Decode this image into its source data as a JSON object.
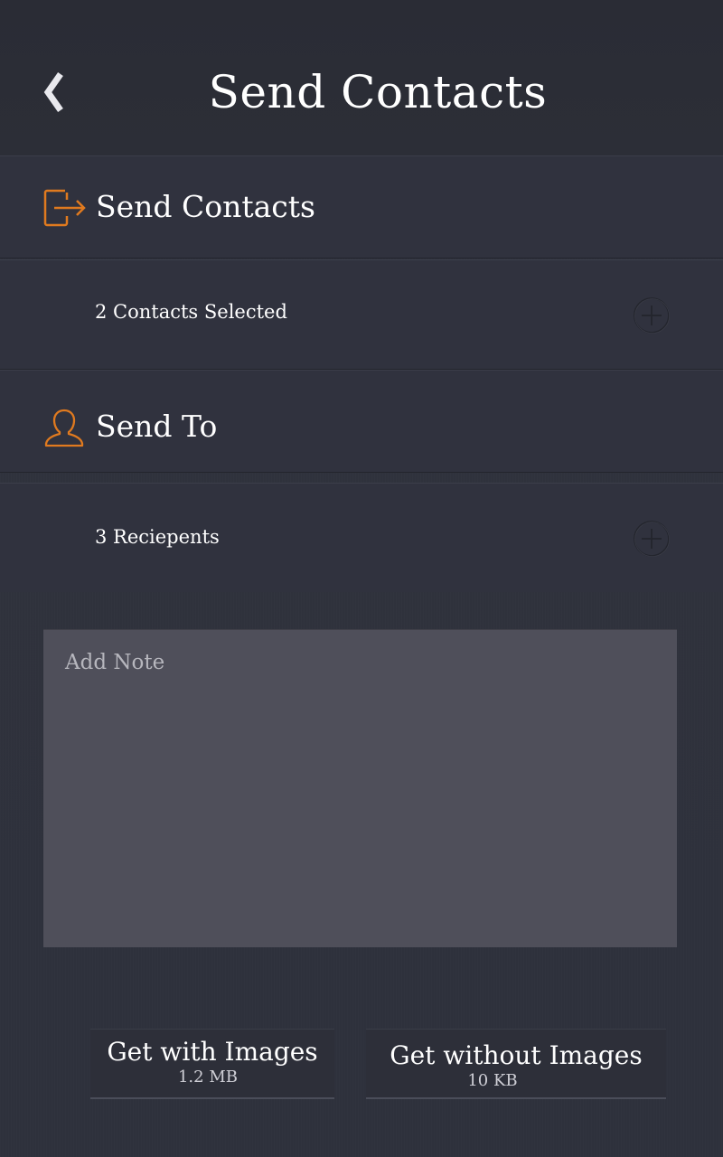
{
  "header": {
    "title": "Send Contacts",
    "back_icon": "chevron-left-icon"
  },
  "send_contacts_section": {
    "label": "Send Contacts",
    "icon": "sign-out-icon",
    "icon_color": "#e07a1f",
    "row_label": "2 Contacts Selected",
    "row_action_icon": "plus-circle-icon"
  },
  "send_to_section": {
    "label": "Send To",
    "icon": "user-icon",
    "icon_color": "#e07a1f",
    "row_label": "3 Reciepents",
    "row_action_icon": "plus-circle-icon"
  },
  "note": {
    "placeholder": "Add Note",
    "value": ""
  },
  "buttons": {
    "with_images": {
      "label": "Get with Images",
      "size": "1.2 MB"
    },
    "without_images": {
      "label": "Get without Images",
      "size": "10 KB"
    }
  },
  "colors": {
    "accent": "#e07a1f",
    "background": "#2f313d",
    "note_background": "#4f4f5a"
  }
}
